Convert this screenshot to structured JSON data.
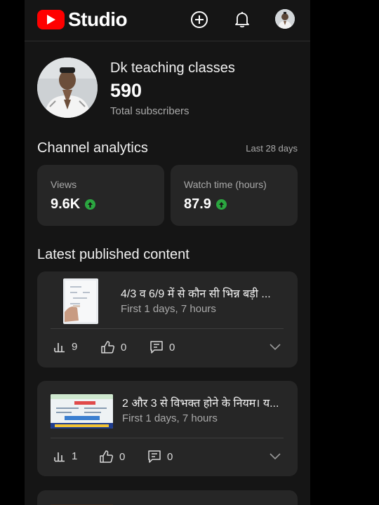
{
  "app": {
    "name": "Studio"
  },
  "header": {
    "icons": [
      "create-icon",
      "notifications-icon",
      "account-avatar"
    ]
  },
  "channel": {
    "name": "Dk teaching classes",
    "subscriber_count": "590",
    "subscriber_label": "Total subscribers"
  },
  "analytics": {
    "title": "Channel analytics",
    "period": "Last 28 days",
    "cards": [
      {
        "label": "Views",
        "value": "9.6K",
        "trend": "up"
      },
      {
        "label": "Watch time (hours)",
        "value": "87.9",
        "trend": "up"
      }
    ]
  },
  "latest": {
    "title": "Latest published content",
    "items": [
      {
        "title": "4/3 व 6/9 में से कौन सी भिन्न बड़ी ...",
        "time": "First 1 days, 7 hours",
        "views": "9",
        "likes": "0",
        "comments": "0"
      },
      {
        "title": "2 और 3 से विभक्त होने के नियम। य...",
        "time": "First 1 days, 7 hours",
        "views": "1",
        "likes": "0",
        "comments": "0"
      }
    ]
  },
  "colors": {
    "background": "#151515",
    "card": "#262626",
    "brand_red": "#ff0000",
    "trend_green": "#2ba640",
    "secondary_text": "#aaaaaa"
  }
}
